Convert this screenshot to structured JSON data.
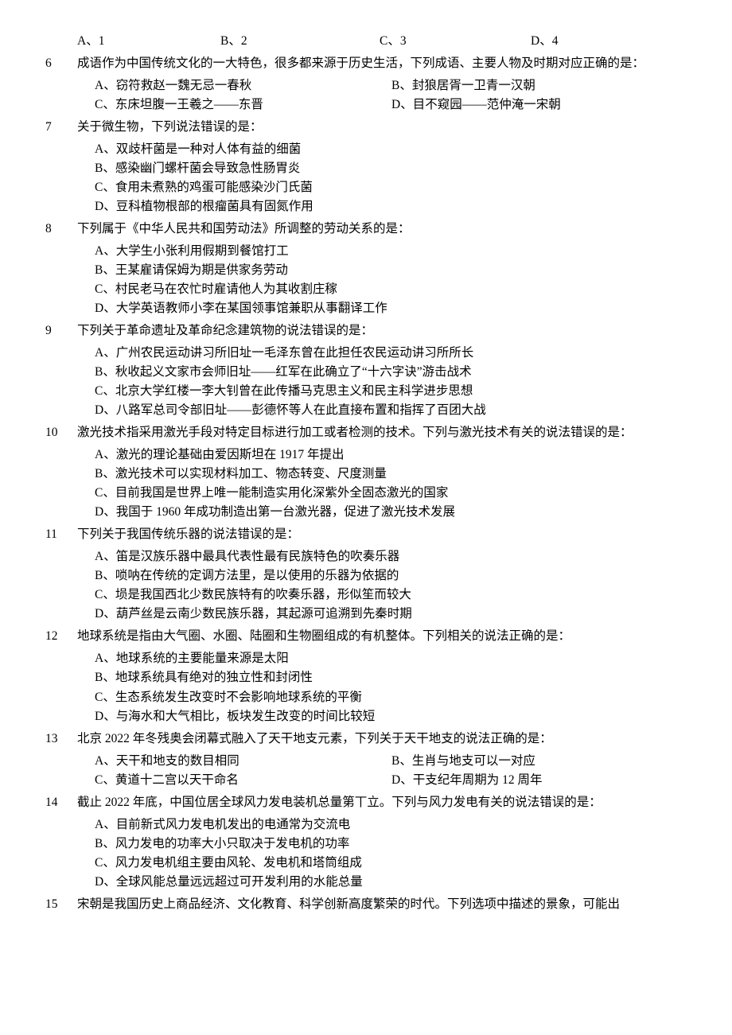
{
  "q5": {
    "A": "A、1",
    "B": "B、2",
    "C": "C、3",
    "D": "D、4"
  },
  "q6": {
    "num": "6",
    "stem": "成语作为中国传统文化的一大特色，很多都来源于历史生活，下列成语、主要人物及时期对应正确的是：",
    "A": "A、窃符救赵一魏无忌一春秋",
    "B": "B、封狼居胥一卫青一汉朝",
    "C": "C、东床坦腹一王羲之——东晋",
    "D": "D、目不窥园——范仲淹一宋朝"
  },
  "q7": {
    "num": "7",
    "stem": "关于微生物，下列说法错误的是：",
    "A": "A、双歧杆菌是一种对人体有益的细菌",
    "B": "B、感染幽门螺杆菌会导致急性肠胃炎",
    "C": "C、食用未煮熟的鸡蛋可能感染沙门氏菌",
    "D": "D、豆科植物根部的根瘤菌具有固氮作用"
  },
  "q8": {
    "num": "8",
    "stem": "下列属于《中华人民共和国劳动法》所调整的劳动关系的是：",
    "A": "A、大学生小张利用假期到餐馆打工",
    "B": "B、王某雇请保姆为期是供家务劳动",
    "C": "C、村民老马在农忙时雇请他人为其收割庄稼",
    "D": "D、大学英语教师小李在某国领事馆兼职从事翻译工作"
  },
  "q9": {
    "num": "9",
    "stem": "下列关于革命遗址及革命纪念建筑物的说法错误的是：",
    "A": "A、广州农民运动讲习所旧址一毛泽东曾在此担任农民运动讲习所所长",
    "B": "B、秋收起义文家市会师旧址——红军在此确立了“十六字诀”游击战术",
    "C": "C、北京大学红楼一李大钊曾在此传播马克思主义和民主科学进步思想",
    "D": "D、八路军总司令部旧址——彭德怀等人在此直接布置和指挥了百团大战"
  },
  "q10": {
    "num": "10",
    "stem": "激光技术指采用激光手段对特定目标进行加工或者检测的技术。下列与激光技术有关的说法错误的是：",
    "A": "A、激光的理论基础由爱因斯坦在 1917 年提出",
    "B": "B、激光技术可以实现材料加工、物态转变、尺度测量",
    "C": "C、目前我国是世界上唯一能制造实用化深紫外全固态激光的国家",
    "D": "D、我国于 1960 年成功制造出第一台激光器，促进了激光技术发展"
  },
  "q11": {
    "num": "11",
    "stem": "下列关于我国传统乐器的说法错误的是：",
    "A": "A、笛是汉族乐器中最具代表性最有民族特色的吹奏乐器",
    "B": "B、唢呐在传统的定调方法里，是以使用的乐器为依据的",
    "C": "C、埙是我国西北少数民族特有的吹奏乐器，形似笙而较大",
    "D": "D、葫芦丝是云南少数民族乐器，其起源可追溯到先秦时期"
  },
  "q12": {
    "num": "12",
    "stem": "地球系统是指由大气圈、水圈、陆圈和生物圈组成的有机整体。下列相关的说法正确的是：",
    "A": "A、地球系统的主要能量来源是太阳",
    "B": "B、地球系统具有绝对的独立性和封闭性",
    "C": "C、生态系统发生改变时不会影响地球系统的平衡",
    "D": "D、与海水和大气相比，板块发生改变的时间比较短"
  },
  "q13": {
    "num": "13",
    "stem": "北京 2022 年冬残奥会闭幕式融入了天干地支元素，下列关于天干地支的说法正确的是：",
    "A": "A、天干和地支的数目相同",
    "B": "B、生肖与地支可以一对应",
    "C": "C、黄道十二宫以天干命名",
    "D": "D、干支纪年周期为 12 周年"
  },
  "q14": {
    "num": "14",
    "stem": "截止 2022 年底，中国位居全球风力发电装机总量第丅立。下列与风力发电有关的说法错误的是：",
    "A": "A、目前新式风力发电机发出的电通常为交流电",
    "B": "B、风力发电的功率大小只取决于发电机的功率",
    "C": "C、风力发电机组主要由风轮、发电机和塔筒组成",
    "D": "D、全球风能总量远远超过可开发利用的水能总量"
  },
  "q15": {
    "num": "15",
    "stem": "宋朝是我国历史上商品经济、文化教育、科学创新高度繁荣的时代。下列选项中描述的景象，可能出"
  }
}
